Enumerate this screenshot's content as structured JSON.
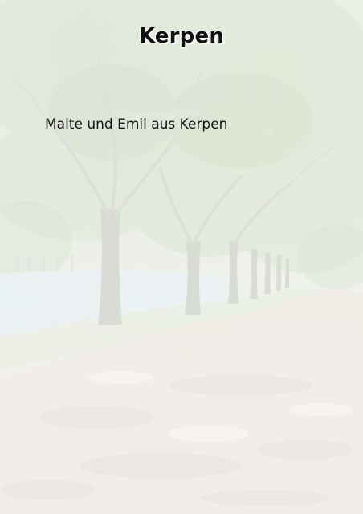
{
  "page": {
    "title": "Kerpen",
    "subtitle": "Malte und Emil aus Kerpen"
  },
  "colors": {
    "text": "#111111",
    "foliage": "#cfdcc4",
    "trunk": "#c9ccc1",
    "path": "#ece6e0",
    "water": "#e6eef0"
  }
}
